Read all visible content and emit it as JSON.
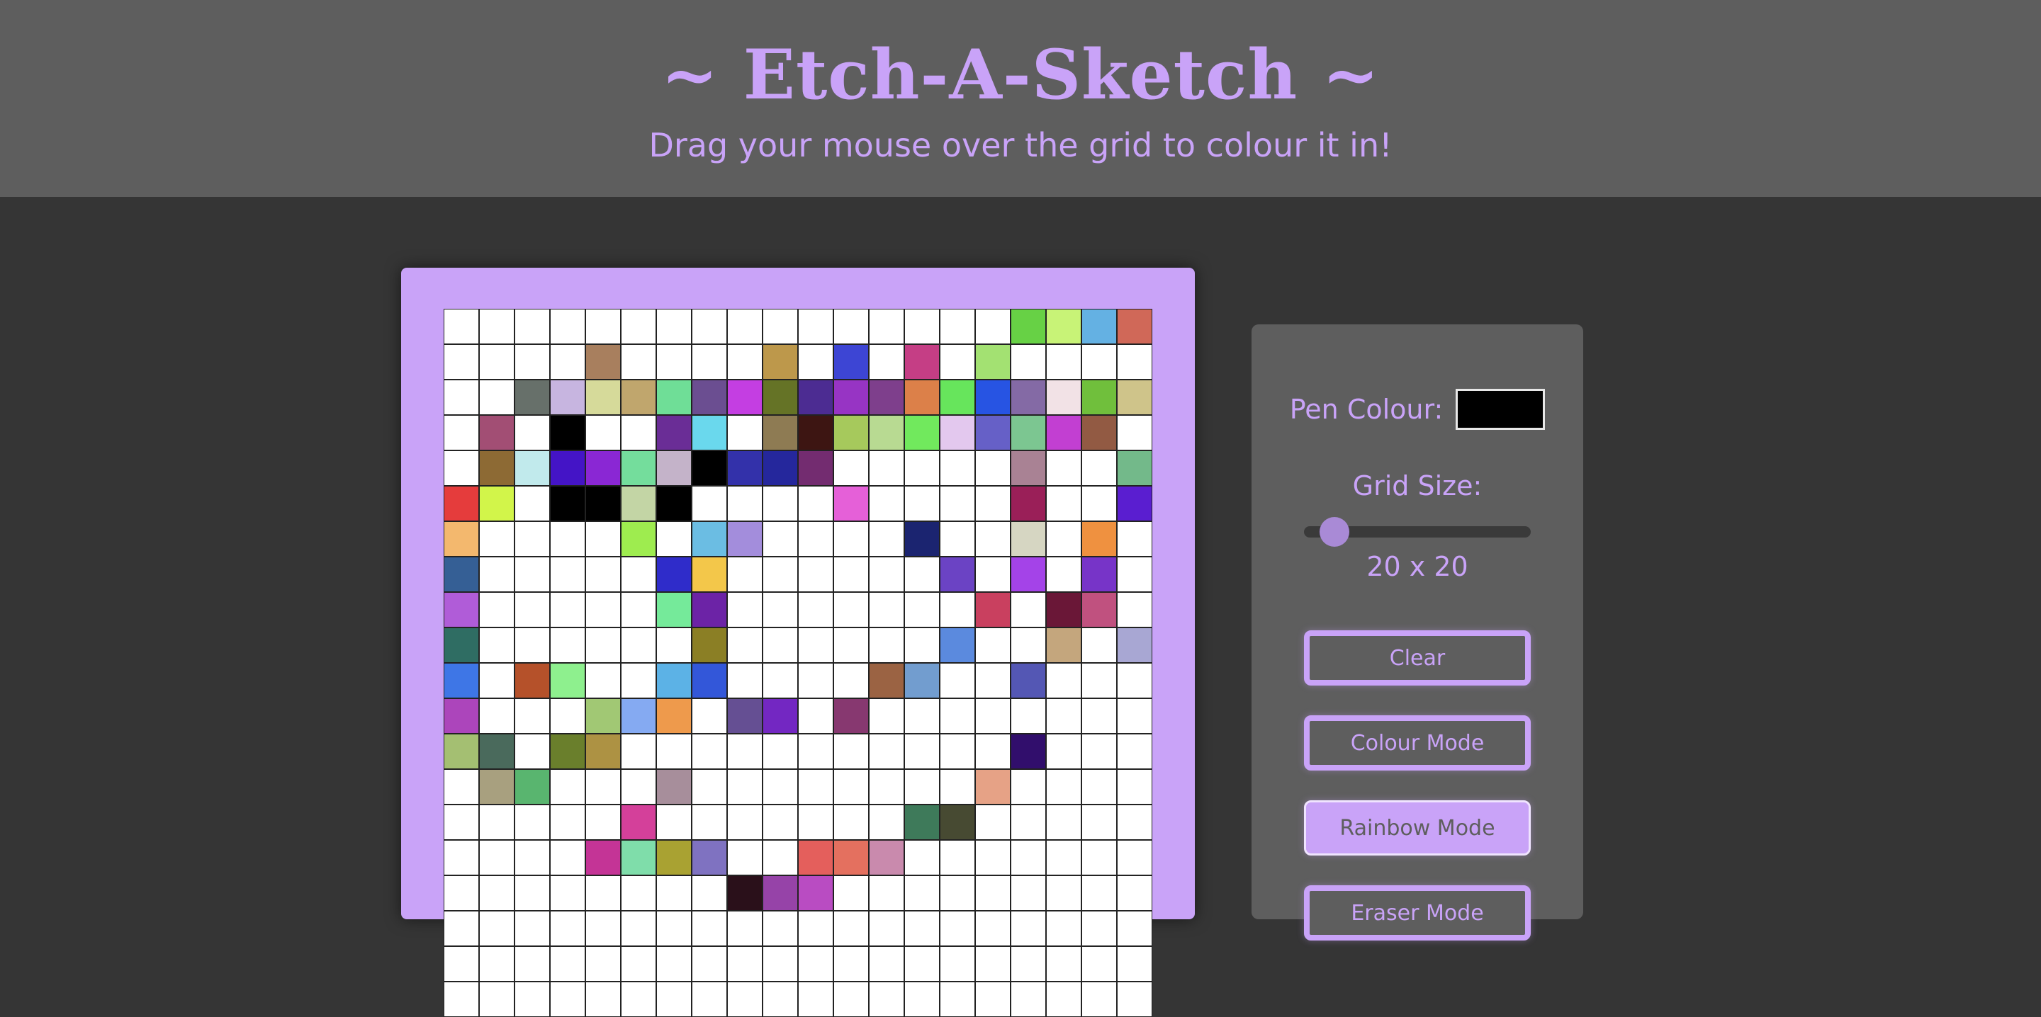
{
  "header": {
    "title": "~ Etch-A-Sketch ~",
    "subtitle": "Drag your mouse over the grid to colour it in!"
  },
  "colors": {
    "accent": "#c9a3f8",
    "page_background": "#353535",
    "panel_background": "#5e5e5e",
    "cell_default": "#ffffff"
  },
  "controls": {
    "pen_colour_label": "Pen Colour:",
    "pen_colour_value": "#000000",
    "grid_size_label": "Grid Size:",
    "grid_size_value": "20 x 20",
    "grid_size": 20,
    "buttons": {
      "clear": "Clear",
      "colour_mode": "Colour Mode",
      "rainbow_mode": "Rainbow Mode",
      "eraser_mode": "Eraser Mode"
    },
    "active_mode": "rainbow_mode"
  },
  "grid": {
    "size": 20,
    "cells": [
      [
        "#ffffff",
        "#ffffff",
        "#ffffff",
        "#ffffff",
        "#ffffff",
        "#ffffff",
        "#ffffff",
        "#ffffff",
        "#ffffff",
        "#ffffff",
        "#ffffff",
        "#ffffff",
        "#ffffff",
        "#ffffff",
        "#ffffff",
        "#ffffff",
        "#67d145",
        "#c8f377",
        "#64b1e3",
        "#d06858"
      ],
      [
        "#ffffff",
        "#ffffff",
        "#ffffff",
        "#ffffff",
        "#a87f5e",
        "#ffffff",
        "#ffffff",
        "#ffffff",
        "#ffffff",
        "#bd984b",
        "#ffffff",
        "#3d45d4",
        "#ffffff",
        "#c53e85",
        "#ffffff",
        "#a3e172",
        "#ffffff",
        "#ffffff",
        "#ffffff",
        "#ffffff"
      ],
      [
        "#ffffff",
        "#ffffff",
        "#67706a",
        "#c7b5e0",
        "#d6da9a",
        "#c0a66d",
        "#6fde97",
        "#6b4e91",
        "#c43ee2",
        "#657326",
        "#4c2c92",
        "#9734c4",
        "#7e3f8c",
        "#dc8049",
        "#67e55c",
        "#2754e3",
        "#846aa5",
        "#f2e2e6",
        "#70bf3c",
        "#cfc48a"
      ],
      [
        "#ffffff",
        "#a24e74",
        "#ffffff",
        "#000000",
        "#ffffff",
        "#ffffff",
        "#6a2d96",
        "#6ad8ed",
        "#ffffff",
        "#8e7b53",
        "#3d1512",
        "#a6c95c",
        "#b8da92",
        "#71e95d",
        "#e3c8ee",
        "#6660c7",
        "#7cc691",
        "#c23fd2",
        "#925a43",
        "#ffffff"
      ],
      [
        "#ffffff",
        "#8d6a34",
        "#c1eaec",
        "#4414c6",
        "#8a27d4",
        "#74dd9c",
        "#c4b3c9",
        "#000000",
        "#3331aa",
        "#25279c",
        "#732c70",
        "#ffffff",
        "#ffffff",
        "#ffffff",
        "#ffffff",
        "#ffffff",
        "#a98294",
        "#ffffff",
        "#ffffff",
        "#73b98a"
      ],
      [
        "#e53c3c",
        "#d2f54a",
        "#ffffff",
        "#000000",
        "#000000",
        "#c3d5a5",
        "#000000",
        "#ffffff",
        "#ffffff",
        "#ffffff",
        "#ffffff",
        "#e560d8",
        "#ffffff",
        "#ffffff",
        "#ffffff",
        "#ffffff",
        "#9a1f58",
        "#ffffff",
        "#ffffff",
        "#5a1ed0"
      ],
      [
        "#f3b86e",
        "#ffffff",
        "#ffffff",
        "#ffffff",
        "#ffffff",
        "#9eec4f",
        "#ffffff",
        "#6bbde3",
        "#a38ddc",
        "#ffffff",
        "#ffffff",
        "#ffffff",
        "#ffffff",
        "#1b2470",
        "#ffffff",
        "#ffffff",
        "#d6d6c2",
        "#ffffff",
        "#ef9140",
        "#ffffff"
      ],
      [
        "#355f95",
        "#ffffff",
        "#ffffff",
        "#ffffff",
        "#ffffff",
        "#ffffff",
        "#2f2cca",
        "#f3c74a",
        "#ffffff",
        "#ffffff",
        "#ffffff",
        "#ffffff",
        "#ffffff",
        "#ffffff",
        "#6b43c4",
        "#ffffff",
        "#a443e8",
        "#ffffff",
        "#7734c8",
        "#ffffff"
      ],
      [
        "#b05cd8",
        "#ffffff",
        "#ffffff",
        "#ffffff",
        "#ffffff",
        "#ffffff",
        "#75ea9a",
        "#6c23a6",
        "#ffffff",
        "#ffffff",
        "#ffffff",
        "#ffffff",
        "#ffffff",
        "#ffffff",
        "#ffffff",
        "#c9405f",
        "#ffffff",
        "#6a1737",
        "#c0517f",
        "#ffffff"
      ],
      [
        "#2f6d63",
        "#ffffff",
        "#ffffff",
        "#ffffff",
        "#ffffff",
        "#ffffff",
        "#ffffff",
        "#8b7f25",
        "#ffffff",
        "#ffffff",
        "#ffffff",
        "#ffffff",
        "#ffffff",
        "#ffffff",
        "#5b8ade",
        "#ffffff",
        "#ffffff",
        "#c4a67d",
        "#ffffff",
        "#a8a7d3"
      ],
      [
        "#3e76e6",
        "#ffffff",
        "#b5512a",
        "#8ef08e",
        "#ffffff",
        "#ffffff",
        "#5cb2e6",
        "#3357d9",
        "#ffffff",
        "#ffffff",
        "#ffffff",
        "#ffffff",
        "#9b6343",
        "#729dcf",
        "#ffffff",
        "#ffffff",
        "#5457b4",
        "#ffffff",
        "#ffffff",
        "#ffffff"
      ],
      [
        "#ac45bb",
        "#ffffff",
        "#ffffff",
        "#ffffff",
        "#a1c874",
        "#85aaf2",
        "#ee9a4c",
        "#ffffff",
        "#654f93",
        "#7327c2",
        "#ffffff",
        "#873870",
        "#ffffff",
        "#ffffff",
        "#ffffff",
        "#ffffff",
        "#ffffff",
        "#ffffff",
        "#ffffff",
        "#ffffff"
      ],
      [
        "#a4bf72",
        "#4a6a5c",
        "#ffffff",
        "#6a7f2c",
        "#ad9243",
        "#ffffff",
        "#ffffff",
        "#ffffff",
        "#ffffff",
        "#ffffff",
        "#ffffff",
        "#ffffff",
        "#ffffff",
        "#ffffff",
        "#ffffff",
        "#ffffff",
        "#310e6c",
        "#ffffff",
        "#ffffff",
        "#ffffff"
      ],
      [
        "#ffffff",
        "#a8a07f",
        "#59b56f",
        "#ffffff",
        "#ffffff",
        "#ffffff",
        "#a78e9b",
        "#ffffff",
        "#ffffff",
        "#ffffff",
        "#ffffff",
        "#ffffff",
        "#ffffff",
        "#ffffff",
        "#ffffff",
        "#e6a286",
        "#ffffff",
        "#ffffff",
        "#ffffff",
        "#ffffff"
      ],
      [
        "#ffffff",
        "#ffffff",
        "#ffffff",
        "#ffffff",
        "#ffffff",
        "#d4409a",
        "#ffffff",
        "#ffffff",
        "#ffffff",
        "#ffffff",
        "#ffffff",
        "#ffffff",
        "#ffffff",
        "#3e7a5a",
        "#474a32",
        "#ffffff",
        "#ffffff",
        "#ffffff",
        "#ffffff",
        "#ffffff"
      ],
      [
        "#ffffff",
        "#ffffff",
        "#ffffff",
        "#ffffff",
        "#c43496",
        "#7fddaa",
        "#a9a232",
        "#7f72c1",
        "#ffffff",
        "#ffffff",
        "#e45f5c",
        "#e4705f",
        "#c98aad",
        "#ffffff",
        "#ffffff",
        "#ffffff",
        "#ffffff",
        "#ffffff",
        "#ffffff",
        "#ffffff"
      ],
      [
        "#ffffff",
        "#ffffff",
        "#ffffff",
        "#ffffff",
        "#ffffff",
        "#ffffff",
        "#ffffff",
        "#ffffff",
        "#2a101a",
        "#9643a8",
        "#b94cc2",
        "#ffffff",
        "#ffffff",
        "#ffffff",
        "#ffffff",
        "#ffffff",
        "#ffffff",
        "#ffffff",
        "#ffffff",
        "#ffffff"
      ],
      [
        "#ffffff",
        "#ffffff",
        "#ffffff",
        "#ffffff",
        "#ffffff",
        "#ffffff",
        "#ffffff",
        "#ffffff",
        "#ffffff",
        "#ffffff",
        "#ffffff",
        "#ffffff",
        "#ffffff",
        "#ffffff",
        "#ffffff",
        "#ffffff",
        "#ffffff",
        "#ffffff",
        "#ffffff",
        "#ffffff"
      ],
      [
        "#ffffff",
        "#ffffff",
        "#ffffff",
        "#ffffff",
        "#ffffff",
        "#ffffff",
        "#ffffff",
        "#ffffff",
        "#ffffff",
        "#ffffff",
        "#ffffff",
        "#ffffff",
        "#ffffff",
        "#ffffff",
        "#ffffff",
        "#ffffff",
        "#ffffff",
        "#ffffff",
        "#ffffff",
        "#ffffff"
      ],
      [
        "#ffffff",
        "#ffffff",
        "#ffffff",
        "#ffffff",
        "#ffffff",
        "#ffffff",
        "#ffffff",
        "#ffffff",
        "#ffffff",
        "#ffffff",
        "#ffffff",
        "#ffffff",
        "#ffffff",
        "#ffffff",
        "#ffffff",
        "#ffffff",
        "#ffffff",
        "#ffffff",
        "#ffffff",
        "#ffffff"
      ]
    ]
  }
}
